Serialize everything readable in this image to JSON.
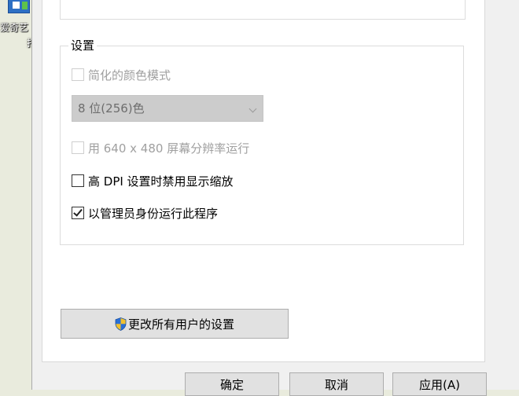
{
  "desktop": {
    "icon_label": "爱奇艺",
    "icon_label_2": "打"
  },
  "settings_group": {
    "title": "设置",
    "reduced_color_mode": {
      "label": "简化的颜色模式",
      "checked": false,
      "disabled": true
    },
    "color_depth": {
      "value": "8 位(256)色",
      "disabled": true
    },
    "run_640x480": {
      "label": "用 640 x 480 屏幕分辨率运行",
      "checked": false,
      "disabled": true
    },
    "disable_dpi_scaling": {
      "label": "高 DPI 设置时禁用显示缩放",
      "checked": false,
      "disabled": false
    },
    "run_as_admin": {
      "label": "以管理员身份运行此程序",
      "checked": true,
      "disabled": false
    }
  },
  "change_all_users_button": "更改所有用户的设置",
  "buttons": {
    "ok": "确定",
    "cancel": "取消",
    "apply": "应用(A)"
  },
  "colors": {
    "shield_blue": "#2a6fd6",
    "shield_yellow": "#f2c12e"
  }
}
